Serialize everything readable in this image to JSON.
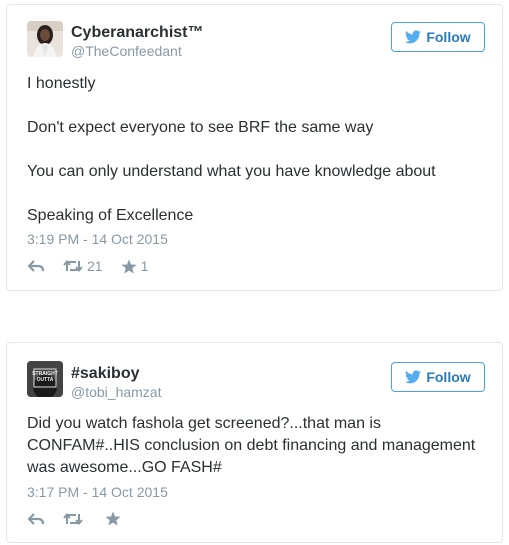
{
  "tweets": [
    {
      "name": "Cyberanarchist™",
      "handle": "@TheConfeedant",
      "follow_label": "Follow",
      "lines": [
        "I honestly",
        "Don't expect everyone to see BRF the same way",
        "You can only understand what you have knowledge about",
        "Speaking of Excellence"
      ],
      "timestamp": "3:19 PM - 14 Oct 2015",
      "retweets": "21",
      "likes": "1"
    },
    {
      "name": "#sakiboy",
      "handle": "@tobi_hamzat",
      "follow_label": "Follow",
      "lines": [
        "Did you watch fashola get screened?...that man is",
        "CONFAM#..HIS conclusion on debt financing and management",
        "was awesome...GO FASH#"
      ],
      "timestamp": "3:17 PM - 14 Oct 2015",
      "avatar_text": "STRAIGHT OUTTA",
      "retweets": "",
      "likes": ""
    }
  ],
  "colors": {
    "twitter_blue": "#2b7bb9",
    "border": "#e1e8ed",
    "muted": "#8899a6"
  }
}
